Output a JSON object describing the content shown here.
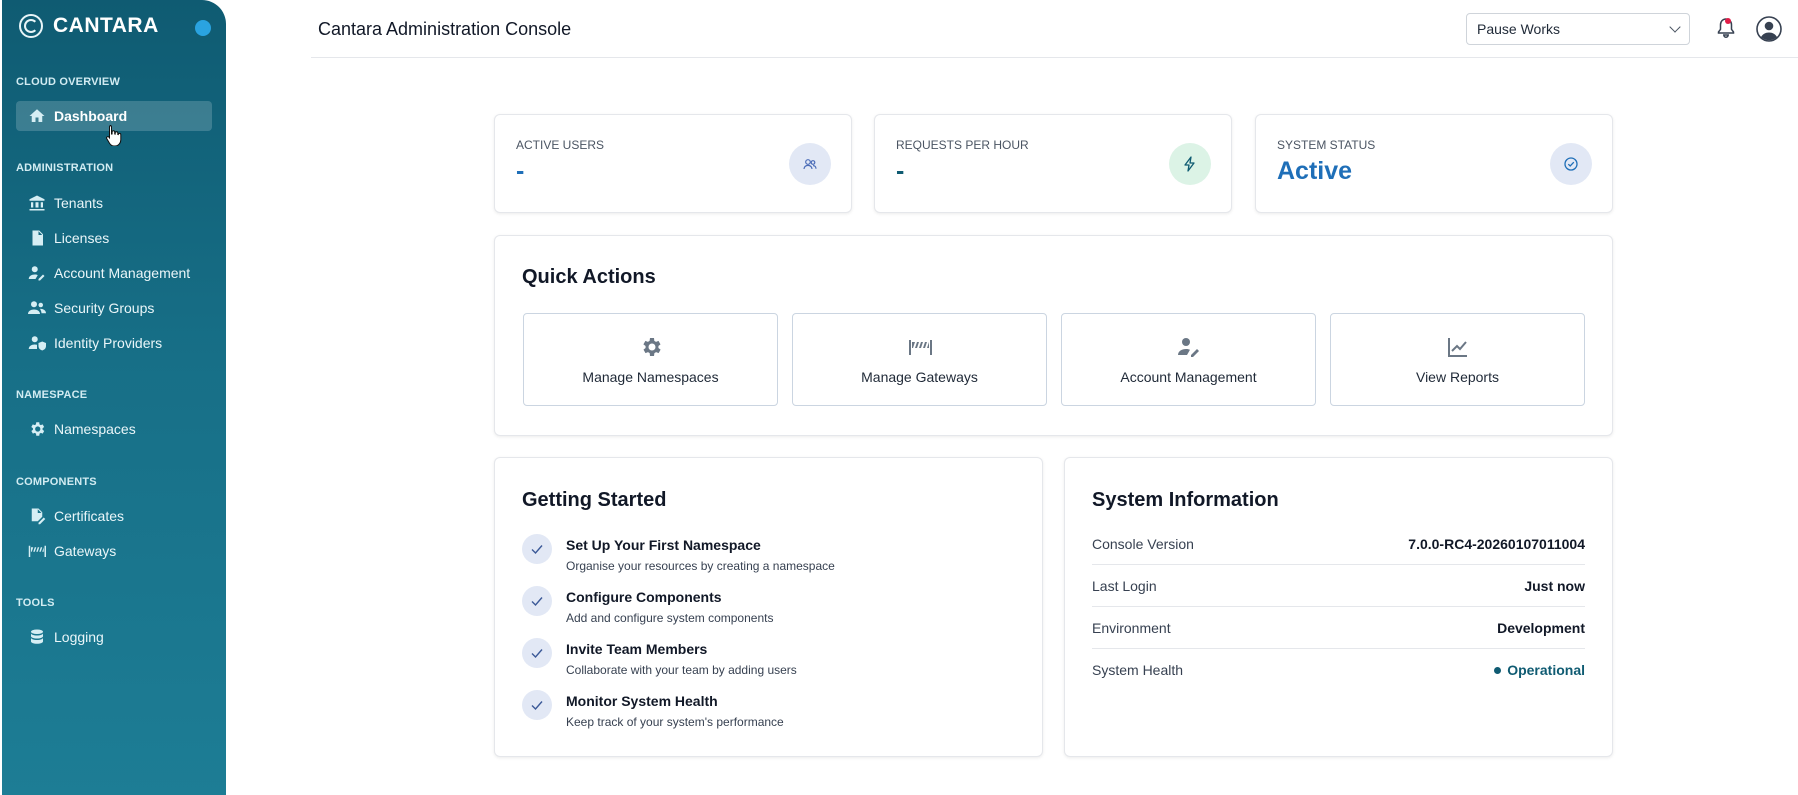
{
  "sidebar": {
    "brand": "CANTARA",
    "sections": {
      "cloud": "CLOUD OVERVIEW",
      "admin": "ADMINISTRATION",
      "namespace": "NAMESPACE",
      "components": "COMPONENTS",
      "tools": "TOOLS"
    },
    "items": {
      "dashboard": "Dashboard",
      "tenants": "Tenants",
      "licenses": "Licenses",
      "account_management": "Account Management",
      "security_groups": "Security Groups",
      "identity_providers": "Identity Providers",
      "namespaces": "Namespaces",
      "certificates": "Certificates",
      "gateways": "Gateways",
      "logging": "Logging"
    }
  },
  "header": {
    "title": "Cantara Administration Console",
    "tenant_selected": "Pause Works"
  },
  "stats": [
    {
      "label": "ACTIVE USERS",
      "value": "-",
      "icon": "users-icon",
      "icon_bg": "#e2e8f5"
    },
    {
      "label": "REQUESTS PER HOUR",
      "value": "-",
      "icon": "bolt-icon",
      "icon_bg": "#dcf3e6"
    },
    {
      "label": "SYSTEM STATUS",
      "value": "Active",
      "icon": "check-circle-icon",
      "icon_bg": "#e2e8f5"
    }
  ],
  "quick_actions": {
    "title": "Quick Actions",
    "items": [
      "Manage Namespaces",
      "Manage Gateways",
      "Account Management",
      "View Reports"
    ]
  },
  "getting_started": {
    "title": "Getting Started",
    "items": [
      {
        "title": "Set Up Your First Namespace",
        "desc": "Organise your resources by creating a namespace"
      },
      {
        "title": "Configure Components",
        "desc": "Add and configure system components"
      },
      {
        "title": "Invite Team Members",
        "desc": "Collaborate with your team by adding users"
      },
      {
        "title": "Monitor System Health",
        "desc": "Keep track of your system's performance"
      }
    ]
  },
  "system_info": {
    "title": "System Information",
    "rows": [
      {
        "key": "Console Version",
        "value": "7.0.0-RC4-20260107011004"
      },
      {
        "key": "Last Login",
        "value": "Just now"
      },
      {
        "key": "Environment",
        "value": "Development"
      },
      {
        "key": "System Health",
        "value": "Operational"
      }
    ]
  },
  "colors": {
    "sidebar": "#0f5b72",
    "accent": "#1f6fb8",
    "status_ok": "#0f5b72"
  }
}
